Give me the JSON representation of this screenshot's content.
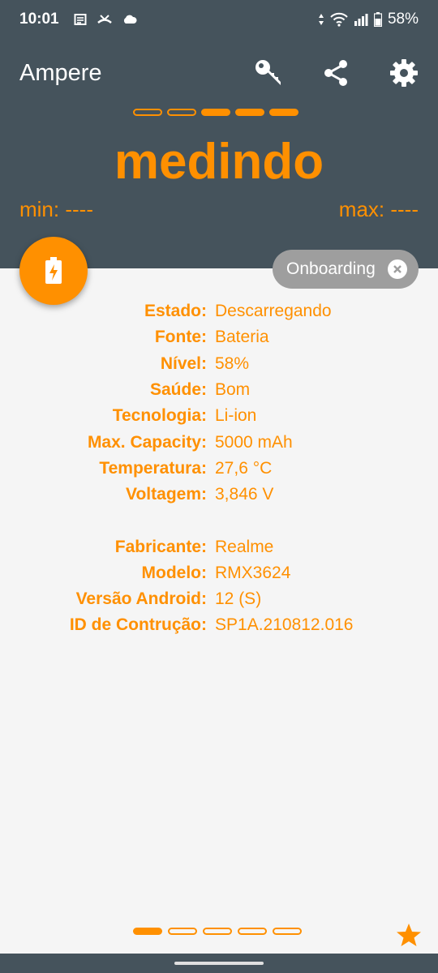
{
  "status_bar": {
    "time": "10:01",
    "battery": "58%"
  },
  "app": {
    "title": "Ampere"
  },
  "header": {
    "state": "medindo",
    "min": "min: ----",
    "max": "max: ----"
  },
  "chip": {
    "label": "Onboarding"
  },
  "info": {
    "group1": [
      {
        "label": "Estado:",
        "value": "Descarregando"
      },
      {
        "label": "Fonte:",
        "value": "Bateria"
      },
      {
        "label": "Nível:",
        "value": "58%"
      },
      {
        "label": "Saúde:",
        "value": "Bom"
      },
      {
        "label": "Tecnologia:",
        "value": "Li-ion"
      },
      {
        "label": "Max. Capacity:",
        "value": "5000 mAh"
      },
      {
        "label": "Temperatura:",
        "value": "27,6 °C"
      },
      {
        "label": "Voltagem:",
        "value": "3,846 V"
      }
    ],
    "group2": [
      {
        "label": "Fabricante:",
        "value": "Realme"
      },
      {
        "label": "Modelo:",
        "value": "RMX3624"
      },
      {
        "label": "Versão Android:",
        "value": "12 (S)"
      },
      {
        "label": "ID de Contrução:",
        "value": "SP1A.210812.016"
      }
    ]
  },
  "colors": {
    "accent": "#ff9000",
    "header_bg": "#45535c",
    "chip_bg": "#9e9e9e"
  }
}
